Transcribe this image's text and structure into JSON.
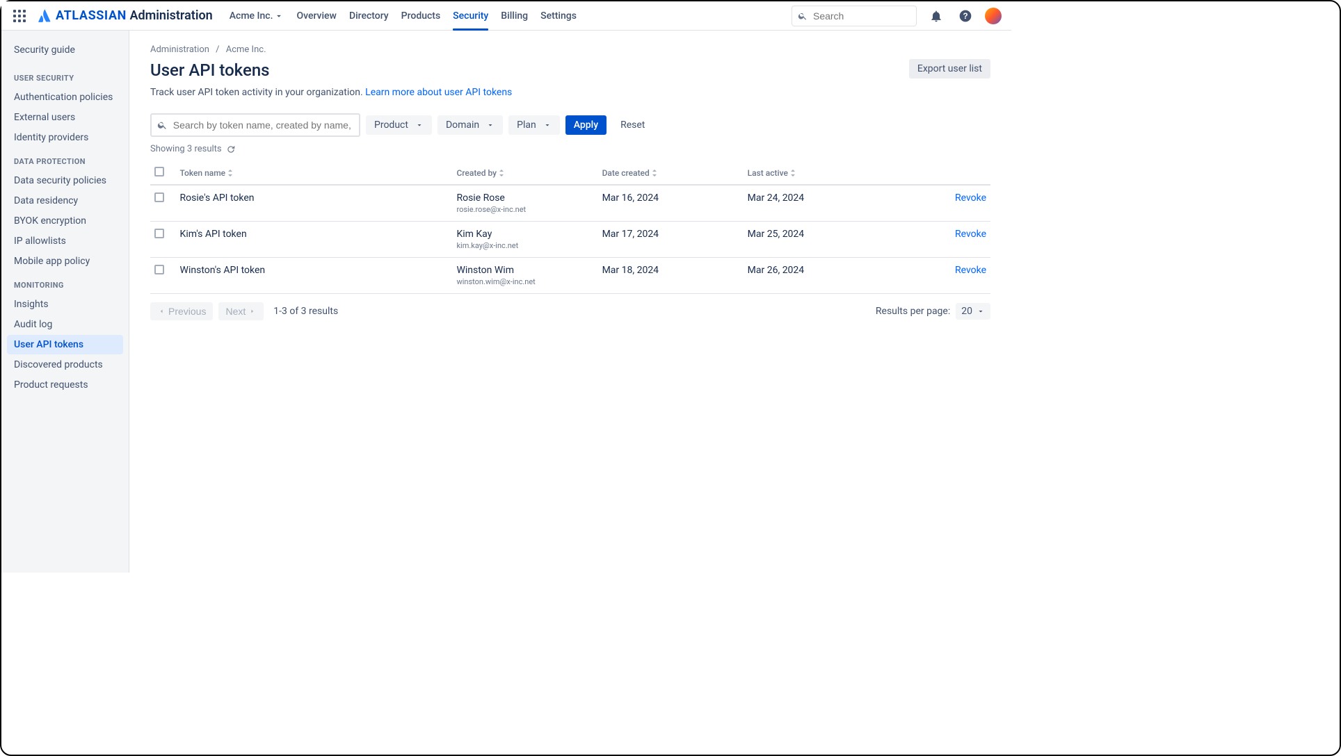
{
  "header": {
    "brand_word": "ATLASSIAN",
    "brand_suffix": "Administration",
    "org_selector": "Acme Inc.",
    "nav": [
      "Overview",
      "Directory",
      "Products",
      "Security",
      "Billing",
      "Settings"
    ],
    "active_nav_index": 3,
    "search_placeholder": "Search"
  },
  "sidebar": {
    "top_link": "Security guide",
    "groups": [
      {
        "heading": "USER SECURITY",
        "items": [
          {
            "label": "Authentication policies"
          },
          {
            "label": "External users"
          },
          {
            "label": "Identity providers"
          }
        ]
      },
      {
        "heading": "DATA PROTECTION",
        "items": [
          {
            "label": "Data security policies"
          },
          {
            "label": "Data residency"
          },
          {
            "label": "BYOK encryption"
          },
          {
            "label": "IP allowlists"
          },
          {
            "label": "Mobile app policy"
          }
        ]
      },
      {
        "heading": "MONITORING",
        "items": [
          {
            "label": "Insights"
          },
          {
            "label": "Audit log"
          },
          {
            "label": "User API tokens",
            "active": true
          },
          {
            "label": "Discovered products"
          },
          {
            "label": "Product requests"
          }
        ]
      }
    ]
  },
  "breadcrumb": {
    "root": "Administration",
    "sep": "/",
    "org": "Acme Inc."
  },
  "page": {
    "title": "User API tokens",
    "export_btn": "Export user list",
    "description": "Track user API token activity in your organization. ",
    "learn_more": "Learn more about user API tokens",
    "search_placeholder": "Search by token name, created by name, or email",
    "filter_product": "Product",
    "filter_domain": "Domain",
    "filter_plan": "Plan",
    "apply": "Apply",
    "reset": "Reset",
    "showing": "Showing 3 results"
  },
  "table": {
    "headers": {
      "token": "Token name",
      "created": "Created by",
      "date": "Date created",
      "active": "Last active"
    },
    "revoke_label": "Revoke",
    "rows": [
      {
        "token": "Rosie's API token",
        "name": "Rosie Rose",
        "email": "rosie.rose@x-inc.net",
        "date": "Mar 16, 2024",
        "active": "Mar 24, 2024"
      },
      {
        "token": "Kim's API token",
        "name": "Kim Kay",
        "email": "kim.kay@x-inc.net",
        "date": "Mar 17, 2024",
        "active": "Mar 25, 2024"
      },
      {
        "token": "Winston's API token",
        "name": "Winston Wim",
        "email": "winston.wim@x-inc.net",
        "date": "Mar 18, 2024",
        "active": "Mar 26, 2024"
      }
    ]
  },
  "pagination": {
    "prev": "Previous",
    "next": "Next",
    "count": "1-3 of 3 results",
    "per_page_label": "Results per page:",
    "per_page_value": "20"
  }
}
